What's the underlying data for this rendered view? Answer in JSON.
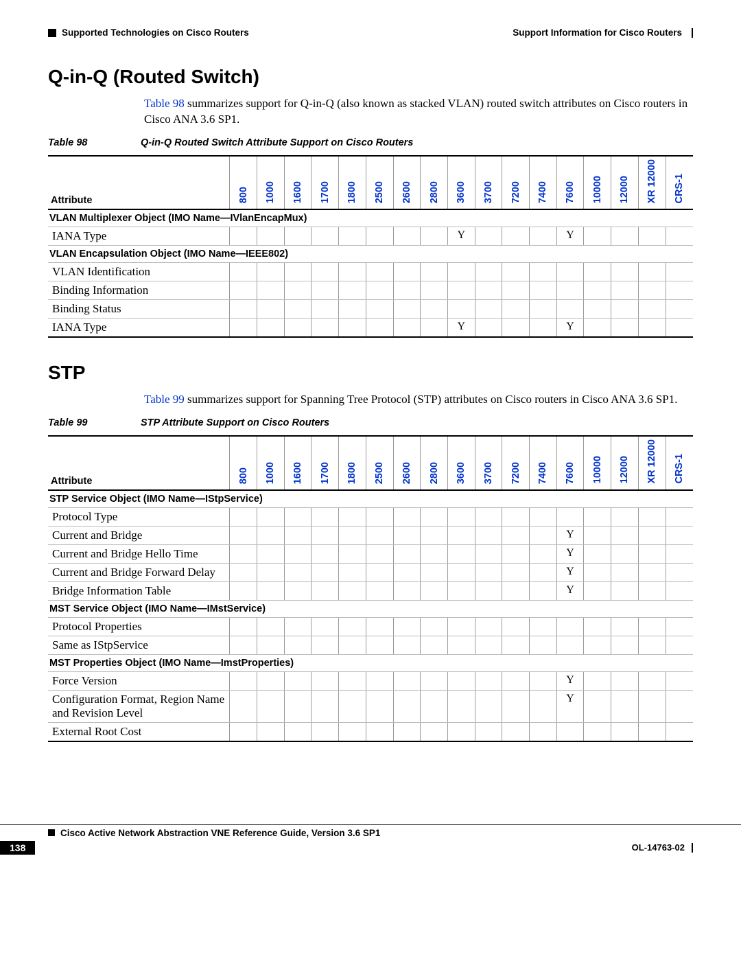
{
  "header": {
    "chapter": "Support Information for Cisco Routers",
    "section": "Supported Technologies on Cisco Routers"
  },
  "sections": [
    {
      "title": "Q-in-Q (Routed Switch)",
      "para_pre": "",
      "table_ref": "Table 98",
      "para_post": " summarizes support for Q-in-Q (also known as stacked VLAN) routed switch attributes on Cisco routers in Cisco ANA 3.6 SP1.",
      "table": {
        "num": "Table 98",
        "caption": "Q-in-Q Routed Switch Attribute Support on Cisco Routers",
        "attr_header": "Attribute",
        "columns": [
          "800",
          "1000",
          "1600",
          "1700",
          "1800",
          "2500",
          "2600",
          "2800",
          "3600",
          "3700",
          "7200",
          "7400",
          "7600",
          "10000",
          "12000",
          "XR 12000",
          "CRS-1"
        ],
        "groups": [
          {
            "label": "VLAN Multiplexer Object (IMO Name—IVlanEncapMux)",
            "rows": [
              {
                "attr": "IANA Type",
                "cells": [
                  "",
                  "",
                  "",
                  "",
                  "",
                  "",
                  "",
                  "",
                  "Y",
                  "",
                  "",
                  "",
                  "Y",
                  "",
                  "",
                  "",
                  ""
                ]
              }
            ]
          },
          {
            "label": "VLAN Encapsulation Object (IMO Name—IEEE802)",
            "rows": [
              {
                "attr": "VLAN Identification",
                "cells": [
                  "",
                  "",
                  "",
                  "",
                  "",
                  "",
                  "",
                  "",
                  "",
                  "",
                  "",
                  "",
                  "",
                  "",
                  "",
                  "",
                  ""
                ]
              },
              {
                "attr": "Binding Information",
                "cells": [
                  "",
                  "",
                  "",
                  "",
                  "",
                  "",
                  "",
                  "",
                  "",
                  "",
                  "",
                  "",
                  "",
                  "",
                  "",
                  "",
                  ""
                ]
              },
              {
                "attr": "Binding Status",
                "cells": [
                  "",
                  "",
                  "",
                  "",
                  "",
                  "",
                  "",
                  "",
                  "",
                  "",
                  "",
                  "",
                  "",
                  "",
                  "",
                  "",
                  ""
                ]
              },
              {
                "attr": "IANA Type",
                "cells": [
                  "",
                  "",
                  "",
                  "",
                  "",
                  "",
                  "",
                  "",
                  "Y",
                  "",
                  "",
                  "",
                  "Y",
                  "",
                  "",
                  "",
                  ""
                ]
              }
            ]
          }
        ]
      }
    },
    {
      "title": "STP",
      "para_pre": "",
      "table_ref": "Table 99",
      "para_post": " summarizes support for Spanning Tree Protocol (STP) attributes on Cisco routers in Cisco ANA 3.6 SP1.",
      "table": {
        "num": "Table 99",
        "caption": "STP Attribute Support on Cisco Routers",
        "attr_header": "Attribute",
        "columns": [
          "800",
          "1000",
          "1600",
          "1700",
          "1800",
          "2500",
          "2600",
          "2800",
          "3600",
          "3700",
          "7200",
          "7400",
          "7600",
          "10000",
          "12000",
          "XR 12000",
          "CRS-1"
        ],
        "groups": [
          {
            "label": "STP Service Object (IMO Name—IStpService)",
            "rows": [
              {
                "attr": "Protocol Type",
                "cells": [
                  "",
                  "",
                  "",
                  "",
                  "",
                  "",
                  "",
                  "",
                  "",
                  "",
                  "",
                  "",
                  "",
                  "",
                  "",
                  "",
                  ""
                ]
              },
              {
                "attr": "Current and Bridge",
                "cells": [
                  "",
                  "",
                  "",
                  "",
                  "",
                  "",
                  "",
                  "",
                  "",
                  "",
                  "",
                  "",
                  "Y",
                  "",
                  "",
                  "",
                  ""
                ]
              },
              {
                "attr": "Current and Bridge Hello Time",
                "cells": [
                  "",
                  "",
                  "",
                  "",
                  "",
                  "",
                  "",
                  "",
                  "",
                  "",
                  "",
                  "",
                  "Y",
                  "",
                  "",
                  "",
                  ""
                ]
              },
              {
                "attr": "Current and Bridge Forward Delay",
                "cells": [
                  "",
                  "",
                  "",
                  "",
                  "",
                  "",
                  "",
                  "",
                  "",
                  "",
                  "",
                  "",
                  "Y",
                  "",
                  "",
                  "",
                  ""
                ]
              },
              {
                "attr": "Bridge Information Table",
                "cells": [
                  "",
                  "",
                  "",
                  "",
                  "",
                  "",
                  "",
                  "",
                  "",
                  "",
                  "",
                  "",
                  "Y",
                  "",
                  "",
                  "",
                  ""
                ]
              }
            ]
          },
          {
            "label": "MST Service Object (IMO Name—IMstService)",
            "rows": [
              {
                "attr": "Protocol Properties",
                "cells": [
                  "",
                  "",
                  "",
                  "",
                  "",
                  "",
                  "",
                  "",
                  "",
                  "",
                  "",
                  "",
                  "",
                  "",
                  "",
                  "",
                  ""
                ]
              },
              {
                "attr": "Same as IStpService",
                "cells": [
                  "",
                  "",
                  "",
                  "",
                  "",
                  "",
                  "",
                  "",
                  "",
                  "",
                  "",
                  "",
                  "",
                  "",
                  "",
                  "",
                  ""
                ]
              }
            ]
          },
          {
            "label": "MST Properties Object (IMO Name—ImstProperties)",
            "rows": [
              {
                "attr": "Force Version",
                "cells": [
                  "",
                  "",
                  "",
                  "",
                  "",
                  "",
                  "",
                  "",
                  "",
                  "",
                  "",
                  "",
                  "Y",
                  "",
                  "",
                  "",
                  ""
                ]
              },
              {
                "attr": "Configuration Format, Region Name and Revision Level",
                "cells": [
                  "",
                  "",
                  "",
                  "",
                  "",
                  "",
                  "",
                  "",
                  "",
                  "",
                  "",
                  "",
                  "Y",
                  "",
                  "",
                  "",
                  ""
                ]
              },
              {
                "attr": "External Root Cost",
                "cells": [
                  "",
                  "",
                  "",
                  "",
                  "",
                  "",
                  "",
                  "",
                  "",
                  "",
                  "",
                  "",
                  "",
                  "",
                  "",
                  "",
                  ""
                ]
              }
            ]
          }
        ]
      }
    }
  ],
  "footer": {
    "guide": "Cisco Active Network Abstraction VNE Reference Guide, Version 3.6 SP1",
    "page": "138",
    "docnum": "OL-14763-02"
  }
}
